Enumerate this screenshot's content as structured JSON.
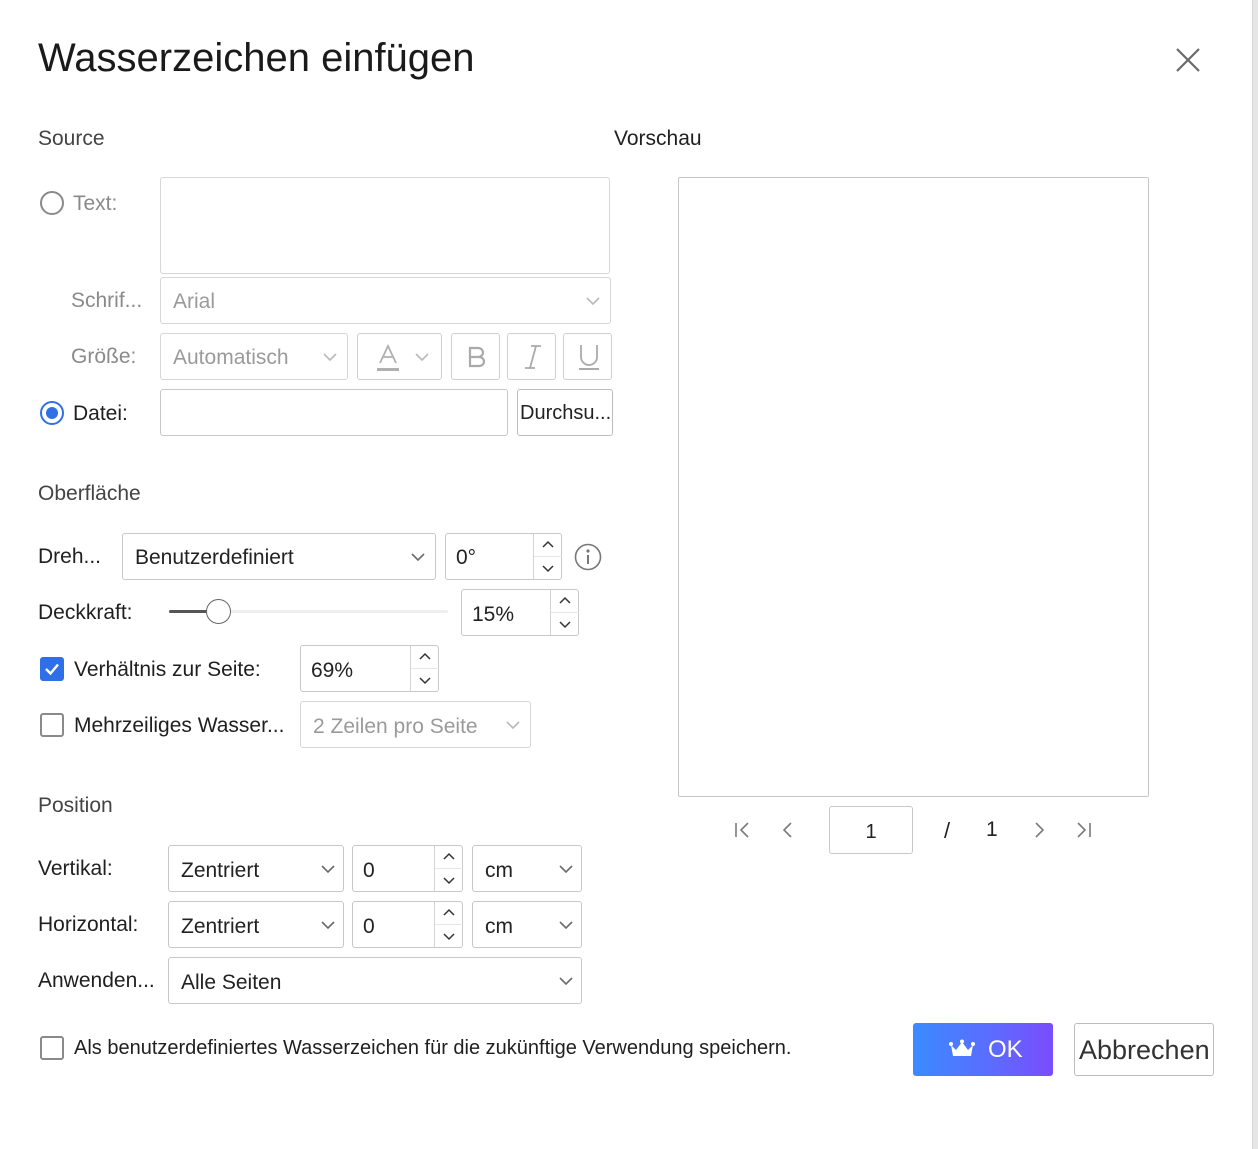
{
  "dialog": {
    "title": "Wasserzeichen einfügen",
    "close_icon": "close-icon"
  },
  "source": {
    "heading": "Source",
    "text_option": {
      "label": "Text:",
      "selected": false,
      "value": ""
    },
    "font": {
      "label": "Schrif...",
      "value": "Arial"
    },
    "size": {
      "label": "Größe:",
      "value": "Automatisch"
    },
    "format_icons": [
      "font-color-icon",
      "bold-icon",
      "italic-icon",
      "underline-icon"
    ],
    "file_option": {
      "label": "Datei:",
      "selected": true,
      "value": "",
      "browse_label": "Durchsu..."
    }
  },
  "preview": {
    "heading": "Vorschau",
    "pager": {
      "current_page": "1",
      "separator": "/",
      "total_pages": "1"
    }
  },
  "appearance": {
    "heading": "Oberfläche",
    "rotation": {
      "label": "Dreh...",
      "mode": "Benutzerdefiniert",
      "value": "0°"
    },
    "opacity": {
      "label": "Deckkraft:",
      "value": "15%",
      "level": 0.15
    },
    "page_ratio": {
      "label": "Verhältnis zur Seite:",
      "checked": true,
      "value": "69%"
    },
    "multiline": {
      "label": "Mehrzeiliges Wasser...",
      "checked": false,
      "value": "2 Zeilen pro Seite"
    }
  },
  "position": {
    "heading": "Position",
    "vertical": {
      "label": "Vertikal:",
      "align": "Zentriert",
      "offset": "0",
      "unit": "cm"
    },
    "horizontal": {
      "label": "Horizontal:",
      "align": "Zentriert",
      "offset": "0",
      "unit": "cm"
    },
    "apply": {
      "label": "Anwenden...",
      "value": "Alle Seiten"
    }
  },
  "footer": {
    "save_custom": {
      "label": "Als benutzerdefiniertes Wasserzeichen für die zukünftige Verwendung speichern.",
      "checked": false
    },
    "ok_label": "OK",
    "cancel_label": "Abbrechen"
  },
  "colors": {
    "accent": "#2f6fe8",
    "ok_gradient_start": "#3a8bff",
    "ok_gradient_end": "#7a4dfc"
  }
}
